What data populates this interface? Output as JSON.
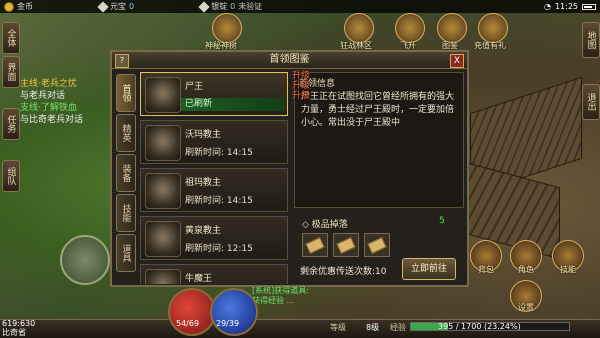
{
  "topbar": {
    "gold_label": "金币",
    "gold_value": "",
    "yuanbao_label": "元宝",
    "yuanbao_value": "0",
    "bind_silver_label": "银锭",
    "bind_silver_value": "0",
    "verify_status": "未验证",
    "time": "11:25"
  },
  "left_tabs": [
    "全体",
    "界面",
    "任务",
    "组队"
  ],
  "quests": [
    {
      "text": "主线·老兵之忧",
      "color": "gold"
    },
    {
      "text": "与老兵对话",
      "color": "white"
    },
    {
      "text": "支线·了解铁血",
      "color": "green"
    },
    {
      "text": "与比奇老兵对话",
      "color": "white"
    }
  ],
  "top_icons": [
    {
      "label": "神秘神树"
    },
    {
      "label": "狂战林区"
    },
    {
      "label": "飞升"
    },
    {
      "label": "图鉴"
    },
    {
      "label": "充值有礼"
    }
  ],
  "right_tabs": [
    "地图",
    "退出"
  ],
  "panel": {
    "title": "首领图鉴",
    "help": "?",
    "close": "X",
    "side_tabs": [
      "首领",
      "精英",
      "装备",
      "技能",
      "道具"
    ],
    "bosses": [
      {
        "name": "尸王",
        "status": "已刷新",
        "active": true
      },
      {
        "name": "沃玛教主",
        "status": "刷新时间: 14:15",
        "active": false
      },
      {
        "name": "祖玛教主",
        "status": "刷新时间: 14:15",
        "active": false
      },
      {
        "name": "黄泉教主",
        "status": "刷新时间: 12:15",
        "active": false
      },
      {
        "name": "牛魔王",
        "status": "",
        "active": false
      }
    ],
    "info_heading": "首领信息",
    "info_text": "尸王正在试图找回它曾经所拥有的强大力量，勇士经过尸王殿时，一定要加倍小心。常出没于尸王殿中",
    "drops_heading": "极品掉落",
    "drops_suffix": "5",
    "drop_items": [
      "scroll-icon",
      "scroll-icon",
      "scroll-icon"
    ],
    "tickets": "剩余优惠传送次数:10",
    "go_button": "立即前往",
    "level_up_text": "升级升级升级"
  },
  "bottom": {
    "coords": "619:630",
    "map": "比奇省",
    "hp": "54/69",
    "mp": "29/39",
    "level_label": "等级",
    "level_value": "8级",
    "exp_label": "经验",
    "exp_value": "395 / 1700 (23.24%)",
    "exp_fraction": 0.2324,
    "chat_lines": [
      "[系统]获得道具:",
      "获得经验 ..."
    ]
  },
  "right_icons": [
    {
      "label": "背包"
    },
    {
      "label": "角色"
    },
    {
      "label": "技能"
    },
    {
      "label": "设置"
    }
  ]
}
